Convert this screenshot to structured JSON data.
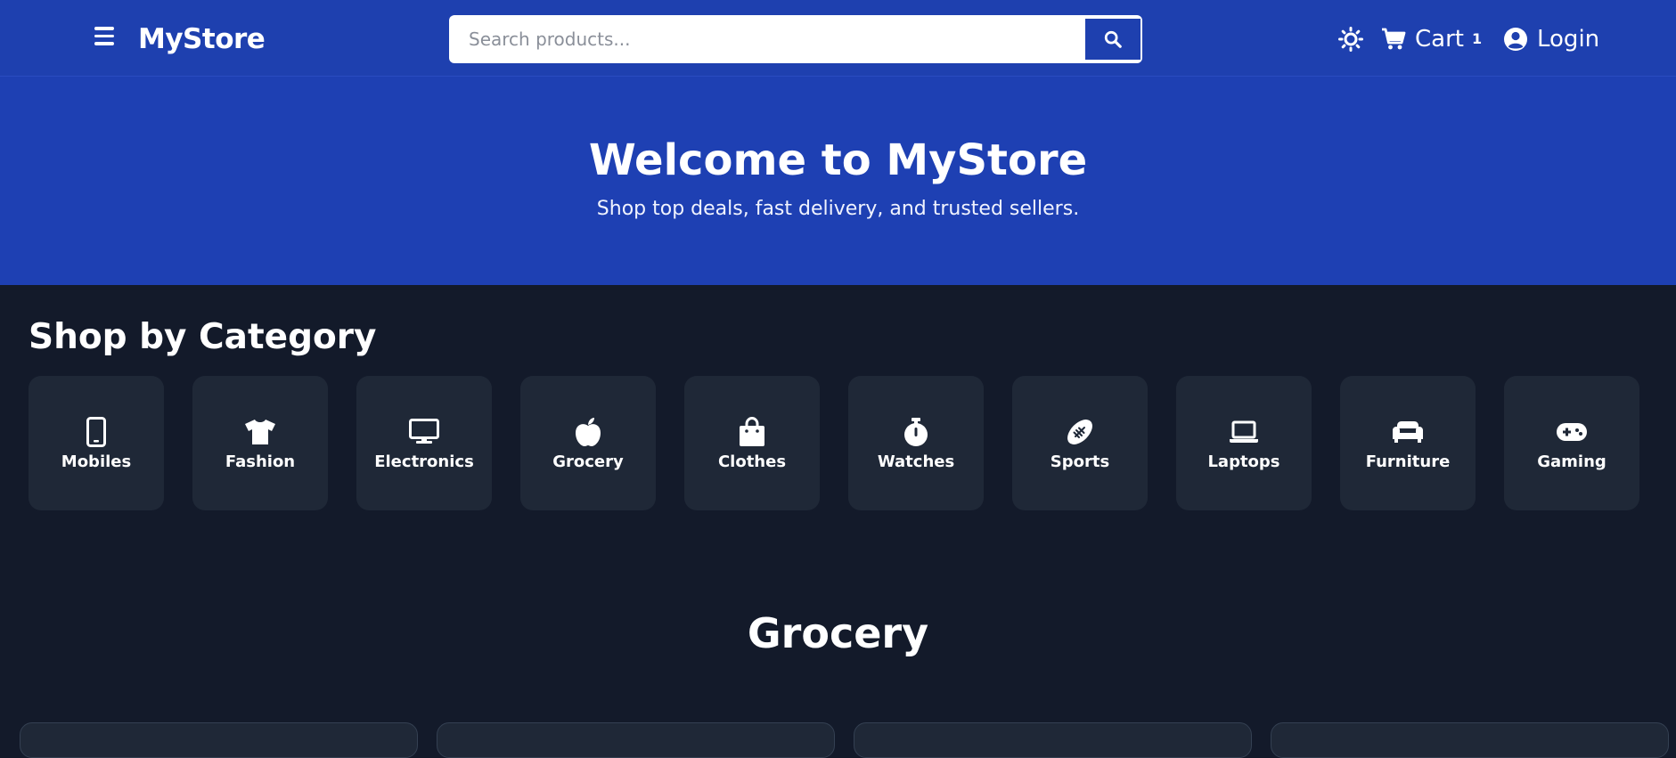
{
  "navbar": {
    "brand": "MyStore",
    "search_placeholder": "Search products...",
    "cart_label": "Cart",
    "cart_count": "1",
    "login_label": "Login",
    "icons": {
      "menu": "hamburger-icon",
      "search": "search-icon",
      "theme": "sun-icon",
      "cart": "cart-icon",
      "login": "user-circle-icon"
    }
  },
  "hero": {
    "title": "Welcome to MyStore",
    "subtitle": "Shop top deals, fast delivery, and trusted sellers."
  },
  "categories": {
    "title": "Shop by Category",
    "items": [
      {
        "label": "Mobiles",
        "icon": "mobile-icon"
      },
      {
        "label": "Fashion",
        "icon": "tshirt-icon"
      },
      {
        "label": "Electronics",
        "icon": "monitor-icon"
      },
      {
        "label": "Grocery",
        "icon": "apple-icon"
      },
      {
        "label": "Clothes",
        "icon": "shopping-bag-icon"
      },
      {
        "label": "Watches",
        "icon": "stopwatch-icon"
      },
      {
        "label": "Sports",
        "icon": "football-icon"
      },
      {
        "label": "Laptops",
        "icon": "laptop-icon"
      },
      {
        "label": "Furniture",
        "icon": "couch-icon"
      },
      {
        "label": "Gaming",
        "icon": "gamepad-icon"
      }
    ]
  },
  "section": {
    "title": "Grocery"
  },
  "colors": {
    "navbar": "#1e40af",
    "hero": "#1e40b3",
    "page_bg": "#131a2a",
    "card_bg": "#1f2837"
  }
}
